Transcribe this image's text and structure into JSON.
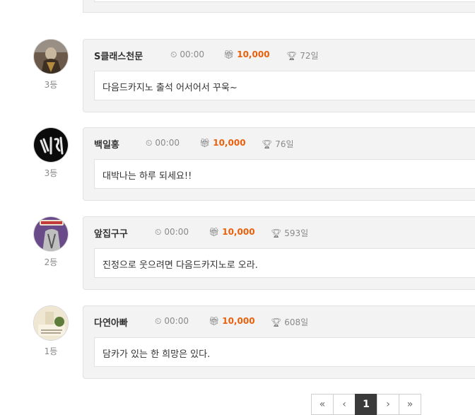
{
  "colors": {
    "point": "#e8600c",
    "card_bg": "#f3f3f3",
    "active_page": "#3a3a3a"
  },
  "icons": {
    "time": "clock-icon",
    "point": "gift-icon",
    "days": "trophy-icon"
  },
  "entries": [
    {
      "nickname": "S클래스천문",
      "time": "00:00",
      "point": "10,000",
      "days": "72일",
      "rank": "3등",
      "message": "다음드카지노 출석 어서어서 꾸욱~"
    },
    {
      "nickname": "백일홍",
      "time": "00:00",
      "point": "10,000",
      "days": "76일",
      "rank": "3등",
      "message": "대박나는 하루 되세요!!"
    },
    {
      "nickname": "앞집구구",
      "time": "00:00",
      "point": "10,000",
      "days": "593일",
      "rank": "2등",
      "message": "진정으로 웃으려면 다음드카지노로 오라."
    },
    {
      "nickname": "다연아빠",
      "time": "00:00",
      "point": "10,000",
      "days": "608일",
      "rank": "1등",
      "message": "담카가 있는 한 희망은 있다."
    }
  ],
  "pagination": {
    "first": "«",
    "prev": "‹",
    "current": "1",
    "next": "›",
    "last": "»"
  }
}
